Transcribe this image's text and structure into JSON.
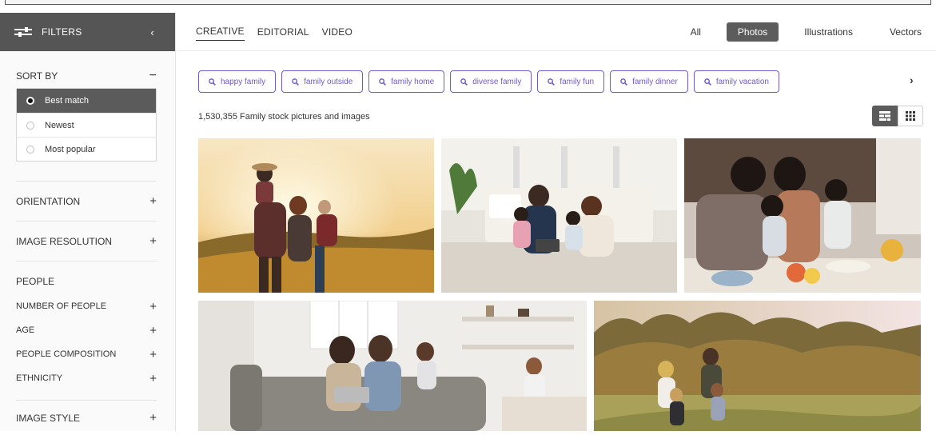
{
  "sidebar": {
    "header_label": "FILTERS",
    "collapse_glyph": "‹",
    "sort_by": {
      "label": "SORT BY",
      "toggle": "−",
      "options": [
        "Best match",
        "Newest",
        "Most popular"
      ],
      "selected": "Best match"
    },
    "sections": {
      "orientation": "ORIENTATION",
      "image_resolution": "IMAGE RESOLUTION",
      "people": "PEOPLE",
      "number_of_people": "NUMBER OF PEOPLE",
      "age": "AGE",
      "people_composition": "PEOPLE COMPOSITION",
      "ethnicity": "ETHNICITY",
      "image_style": "IMAGE STYLE"
    },
    "expand_glyph": "+"
  },
  "content_tabs": [
    "CREATIVE",
    "EDITORIAL",
    "VIDEO"
  ],
  "active_content_tab": "CREATIVE",
  "asset_types": [
    "All",
    "Photos",
    "Illustrations",
    "Vectors"
  ],
  "active_asset_type": "Photos",
  "related_searches": [
    "happy family",
    "family outside",
    "family home",
    "diverse family",
    "family fun",
    "family dinner",
    "family vacation"
  ],
  "next_glyph": "›",
  "results_count_text": "1,530,355 Family stock pictures and images",
  "colors": {
    "accent_purple": "#6d5bd0",
    "dark_gray": "#555555",
    "sidebar_bg": "#fafafa"
  },
  "icons": {
    "filter": "sliders-icon",
    "search": "search-icon",
    "grid_mosaic": "mosaic-grid-icon",
    "grid_square": "square-grid-icon"
  }
}
